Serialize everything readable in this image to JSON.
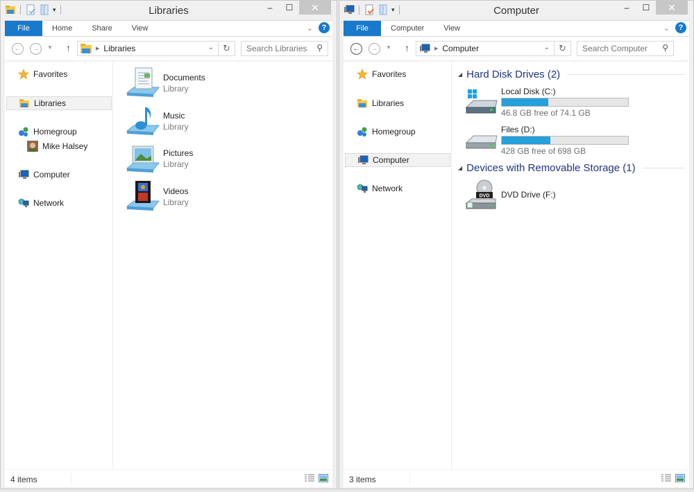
{
  "windows": [
    {
      "id": "libraries",
      "title": "Libraries",
      "ribbon_tabs": [
        {
          "label": "File",
          "active": true
        },
        {
          "label": "Home"
        },
        {
          "label": "Share"
        },
        {
          "label": "View"
        }
      ],
      "address": {
        "crumb": "Libraries"
      },
      "search": {
        "placeholder": "Search Libraries"
      },
      "nav": [
        {
          "label": "Favorites",
          "icon": "star-icon"
        },
        {
          "label": "Libraries",
          "icon": "libraries-icon",
          "selected": true
        },
        {
          "label": "Homegroup",
          "icon": "homegroup-icon"
        },
        {
          "label": "Mike Halsey",
          "icon": "user-avatar-icon",
          "sub": true
        },
        {
          "label": "Computer",
          "icon": "computer-icon"
        },
        {
          "label": "Network",
          "icon": "network-icon"
        }
      ],
      "items": [
        {
          "name": "Documents",
          "type": "Library",
          "icon": "documents-library-icon"
        },
        {
          "name": "Music",
          "type": "Library",
          "icon": "music-library-icon"
        },
        {
          "name": "Pictures",
          "type": "Library",
          "icon": "pictures-library-icon"
        },
        {
          "name": "Videos",
          "type": "Library",
          "icon": "videos-library-icon"
        }
      ],
      "status": "4 items"
    },
    {
      "id": "computer",
      "title": "Computer",
      "ribbon_tabs": [
        {
          "label": "File",
          "active": true
        },
        {
          "label": "Computer"
        },
        {
          "label": "View"
        }
      ],
      "address": {
        "crumb": "Computer"
      },
      "search": {
        "placeholder": "Search Computer"
      },
      "nav": [
        {
          "label": "Favorites",
          "icon": "star-icon"
        },
        {
          "label": "Libraries",
          "icon": "libraries-icon"
        },
        {
          "label": "Homegroup",
          "icon": "homegroup-icon"
        },
        {
          "label": "Computer",
          "icon": "computer-icon",
          "selected": true
        },
        {
          "label": "Network",
          "icon": "network-icon"
        }
      ],
      "groups": [
        {
          "title": "Hard Disk Drives (2)",
          "drives": [
            {
              "name": "Local Disk (C:)",
              "free_text": "46.8 GB free of 74.1 GB",
              "used_fraction": 0.368,
              "icon": "system-drive-icon"
            },
            {
              "name": "Files (D:)",
              "free_text": "428 GB free of 698 GB",
              "used_fraction": 0.387,
              "icon": "hard-drive-icon"
            }
          ]
        },
        {
          "title": "Devices with Removable Storage (1)",
          "drives": [
            {
              "name": "DVD Drive (F:)",
              "icon": "dvd-drive-icon"
            }
          ]
        }
      ],
      "status": "3 items"
    }
  ],
  "colors": {
    "accent": "#1979ca",
    "group_header": "#1e3287",
    "drive_bar_fill": "#26a0da",
    "close_button": "#c7c7c7"
  },
  "caption_buttons": {
    "minimize": "–",
    "maximize": "☐",
    "close": "✕"
  }
}
